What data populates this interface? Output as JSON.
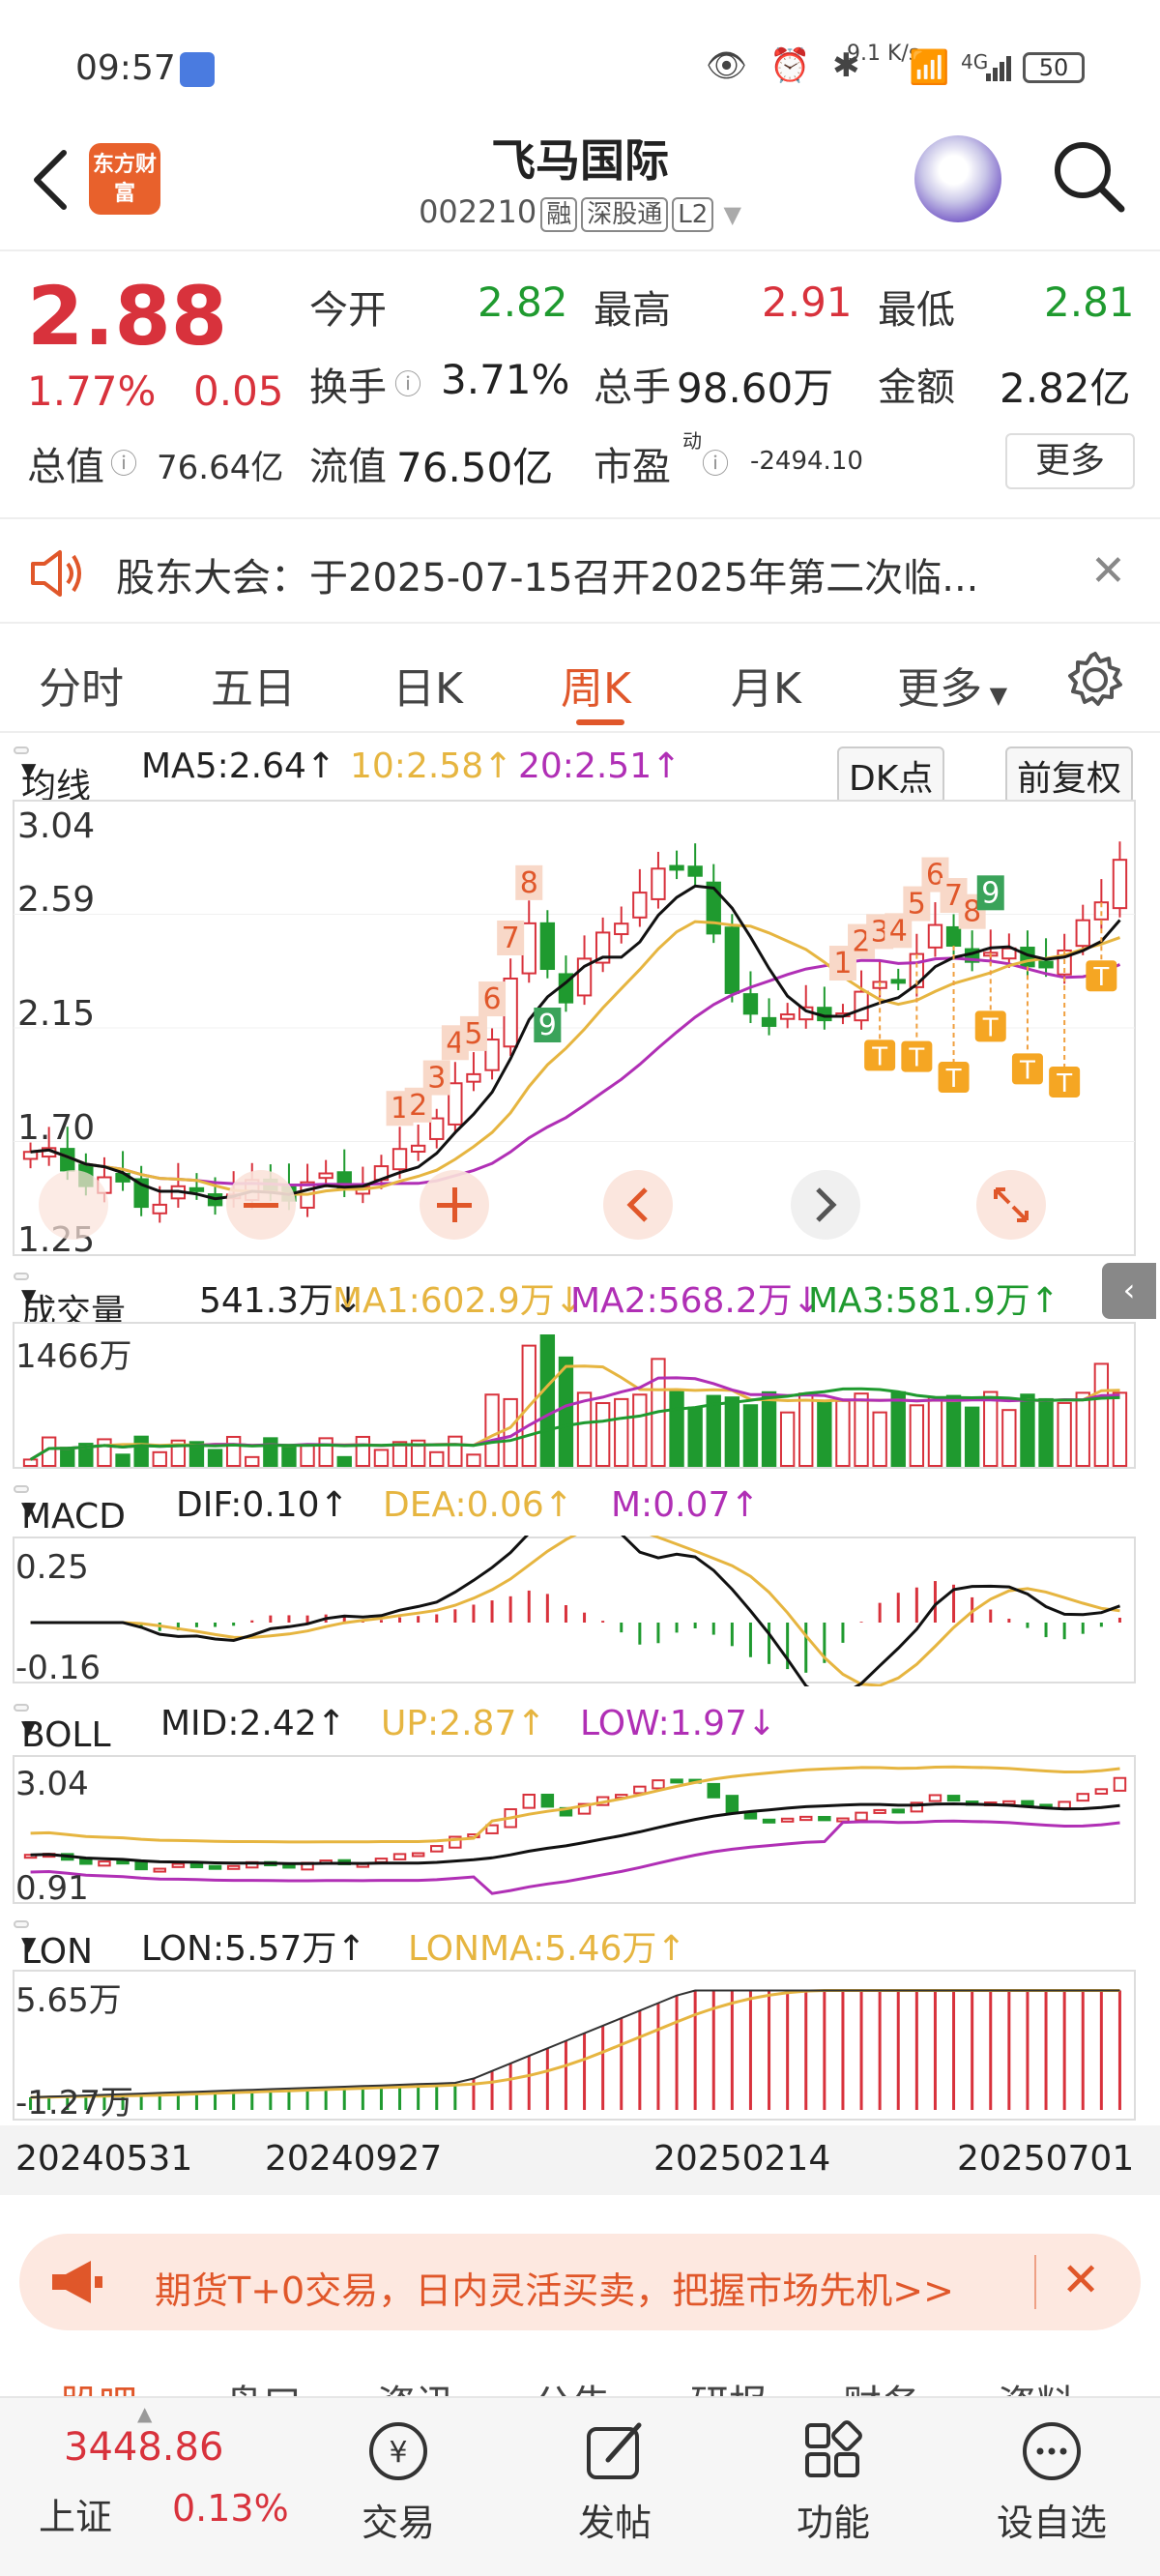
{
  "status_bar": {
    "time": "09:57",
    "speed": "9.1 K/s",
    "signal": "4G",
    "battery": "50"
  },
  "header": {
    "title": "飞马国际",
    "code": "002210",
    "tags": [
      "融",
      "深股通",
      "L2"
    ],
    "logo_text": "东方财富"
  },
  "quote": {
    "price": "2.88",
    "change_pct": "1.77%",
    "change_val": "0.05",
    "fields": [
      {
        "label": "今开",
        "value": "2.82"
      },
      {
        "label": "最高",
        "value": "2.91"
      },
      {
        "label": "最低",
        "value": "2.81"
      },
      {
        "label": "换手",
        "value": "3.71%"
      },
      {
        "label": "总手",
        "value": "98.60万"
      },
      {
        "label": "金额",
        "value": "2.82亿"
      },
      {
        "label": "总值",
        "value": "76.64亿"
      },
      {
        "label": "流值",
        "value": "76.50亿"
      },
      {
        "label": "市盈",
        "sup": "动",
        "value": "-2494.10"
      }
    ],
    "more_label": "更多"
  },
  "notice": {
    "text": "股东大会：于2025-07-15召开2025年第二次临..."
  },
  "period_tabs": {
    "items": [
      "分时",
      "五日",
      "日K",
      "周K",
      "月K",
      "更多"
    ],
    "active": "周K"
  },
  "ma_row": {
    "selector": "均线",
    "ma5": "MA5:2.64↑",
    "ma10": "10:2.58↑",
    "ma20": "20:2.51↑",
    "dk": "DK点",
    "adjust": "前复权"
  },
  "main_chart": {
    "y_ticks": [
      "3.04",
      "2.59",
      "2.15",
      "1.70",
      "1.25"
    ]
  },
  "volume_row": {
    "selector": "成交量",
    "value": "541.3万↓",
    "ma1": "MA1:602.9万↓",
    "ma2": "MA2:568.2万↓",
    "ma3": "MA3:581.9万↑",
    "y_top": "1466万"
  },
  "macd_row": {
    "selector": "MACD",
    "dif": "DIF:0.10↑",
    "dea": "DEA:0.06↑",
    "m": "M:0.07↑",
    "y_top": "0.25",
    "y_bottom": "-0.16"
  },
  "boll_row": {
    "selector": "BOLL",
    "mid": "MID:2.42↑",
    "up": "UP:2.87↑",
    "low": "LOW:1.97↓",
    "y_top": "3.04",
    "y_bottom": "0.91"
  },
  "lon_row": {
    "selector": "LON",
    "lon": "LON:5.57万↑",
    "lonma": "LONMA:5.46万↑",
    "y_top": "5.65万",
    "y_bottom": "-1.27万"
  },
  "date_axis": [
    "20240531",
    "20240927",
    "20250214",
    "20250701"
  ],
  "promo": {
    "text": "期货T+0交易，日内灵活买卖，把握市场先机>>"
  },
  "sub_tabs": [
    "股吧",
    "盘口",
    "资讯",
    "公告",
    "研报",
    "财务",
    "资料"
  ],
  "bottom_bar": {
    "index_value": "3448.86",
    "index_name": "上证",
    "index_pct": "0.13%",
    "items": [
      "交易",
      "发帖",
      "功能",
      "设自选"
    ]
  },
  "colors": {
    "up": "#d8323c",
    "down": "#1f9a2f",
    "accent": "#e0572a",
    "ma10": "#e6b540",
    "ma20": "#b02fb5"
  },
  "icons": [
    "back-icon",
    "search-icon",
    "speaker-icon",
    "close-icon",
    "gear-icon",
    "promo-icon",
    "trade-icon",
    "post-icon",
    "function-icon",
    "add-watchlist-icon"
  ]
}
